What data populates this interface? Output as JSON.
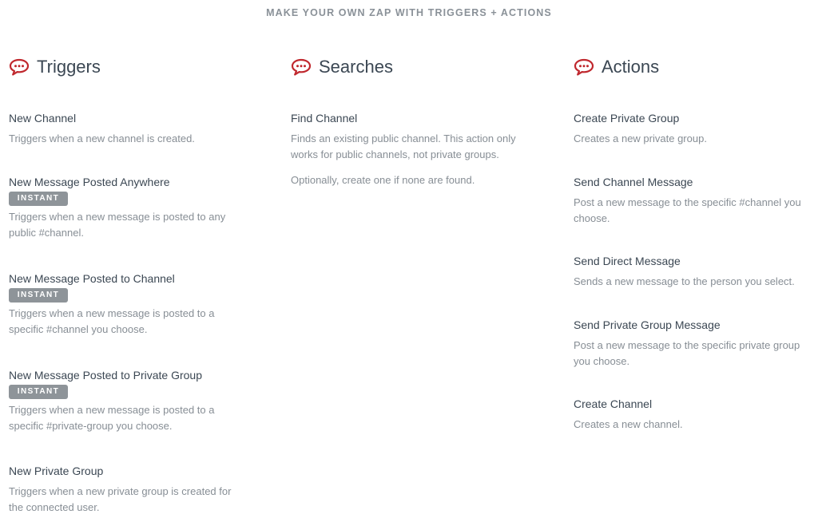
{
  "header": {
    "title": "MAKE YOUR OWN ZAP WITH TRIGGERS + ACTIONS"
  },
  "icons": {
    "column_icon": "chat-bubble-icon",
    "accent_color": "#c0282e"
  },
  "triggers": {
    "title": "Triggers",
    "items": [
      {
        "title": "New Channel",
        "badge": "",
        "description": "Triggers when a new channel is created."
      },
      {
        "title": "New Message Posted Anywhere",
        "badge": "INSTANT",
        "description": "Triggers when a new message is posted to any public #channel."
      },
      {
        "title": "New Message Posted to Channel",
        "badge": "INSTANT",
        "description": "Triggers when a new message is posted to a specific #channel you choose."
      },
      {
        "title": "New Message Posted to Private Group",
        "badge": "INSTANT",
        "description": "Triggers when a new message is posted to a specific #private-group you choose."
      },
      {
        "title": "New Private Group",
        "badge": "",
        "description": "Triggers when a new private group is created for the connected user."
      }
    ]
  },
  "searches": {
    "title": "Searches",
    "items": [
      {
        "title": "Find Channel",
        "description": "Finds an existing public channel. This action only works for public channels, not private groups.",
        "extra": "Optionally, create one if none are found."
      }
    ]
  },
  "actions": {
    "title": "Actions",
    "items": [
      {
        "title": "Create Private Group",
        "description": "Creates a new private group."
      },
      {
        "title": "Send Channel Message",
        "description": "Post a new message to the specific #channel you choose."
      },
      {
        "title": "Send Direct Message",
        "description": "Sends a new message to the person you select."
      },
      {
        "title": "Send Private Group Message",
        "description": "Post a new message to the specific private group you choose."
      },
      {
        "title": "Create Channel",
        "description": "Creates a new channel."
      }
    ]
  }
}
